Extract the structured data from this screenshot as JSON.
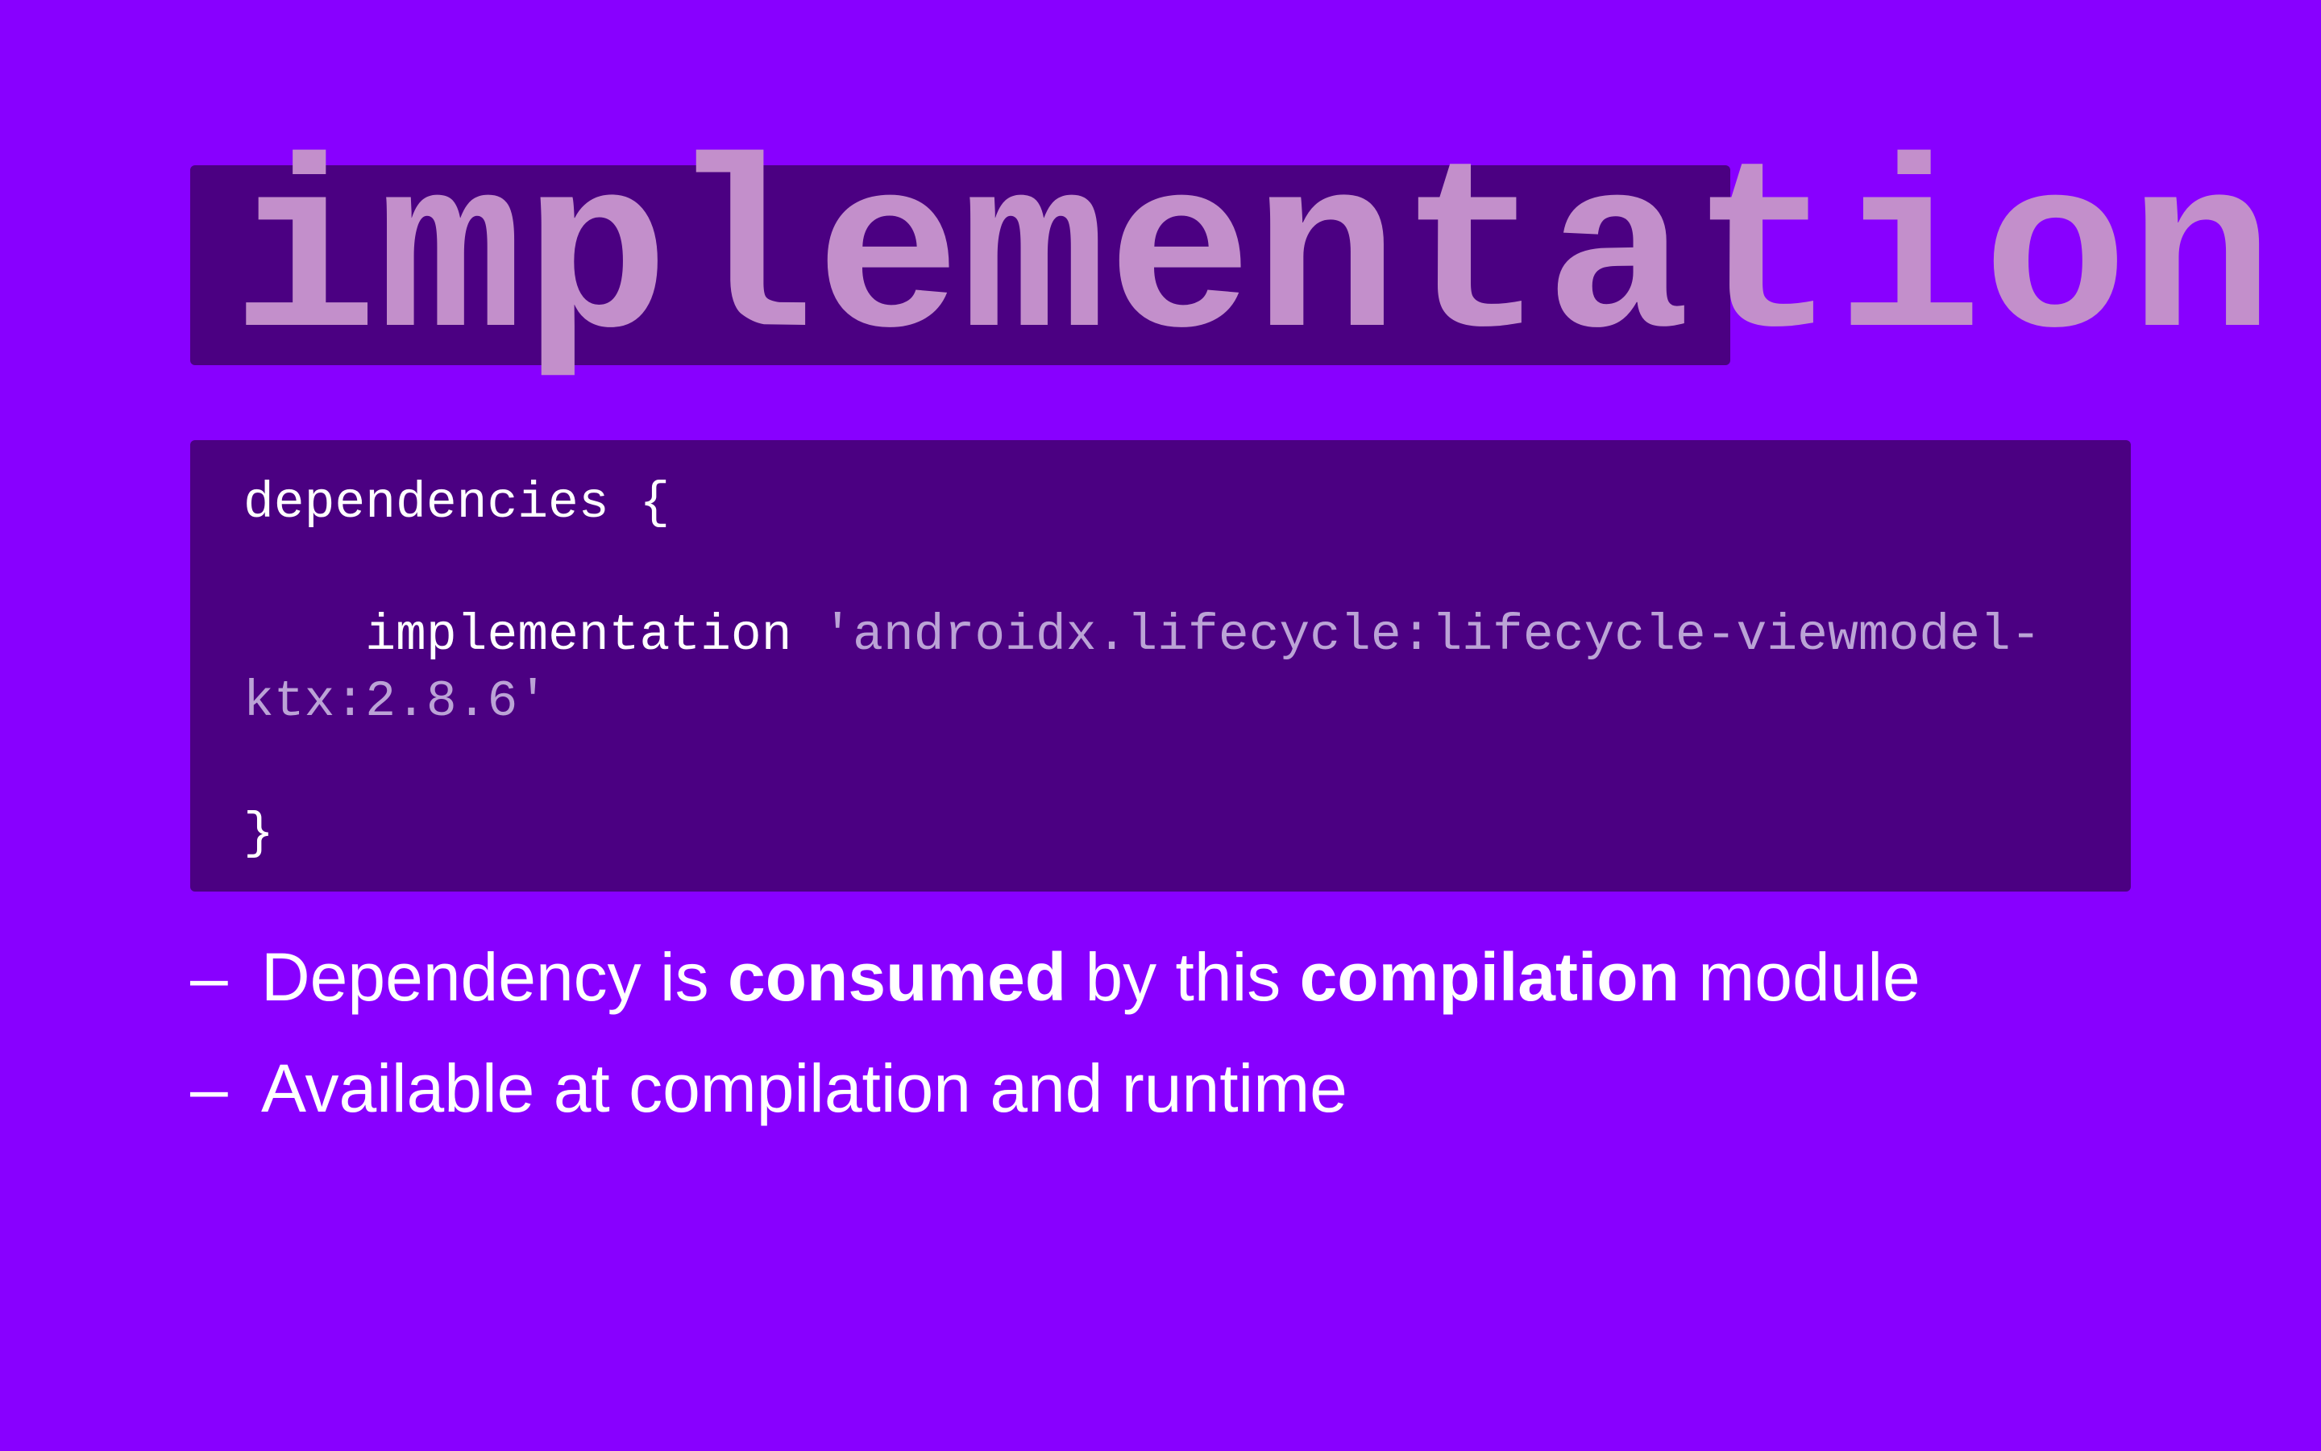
{
  "slide": {
    "title": "implementation",
    "code": {
      "line1": "dependencies {",
      "impl_keyword": "implementation",
      "impl_string_part1": "'androidx.lifecycle:lifecycle-viewmodel-",
      "impl_string_part2": "ktx:2.8.6'",
      "closing": "}"
    },
    "bullets": [
      {
        "dash": "–",
        "t1": "Dependency is ",
        "b1": "consumed",
        "t2": " by this ",
        "b2": "compilation",
        "t3": " module"
      },
      {
        "dash": "–",
        "t1": "Available at compilation and runtime"
      }
    ]
  },
  "colors": {
    "background": "#8800ff",
    "panel": "#4b0082",
    "title_text": "#c38fcb",
    "code_string": "#bba3d6",
    "text": "#ffffff"
  }
}
